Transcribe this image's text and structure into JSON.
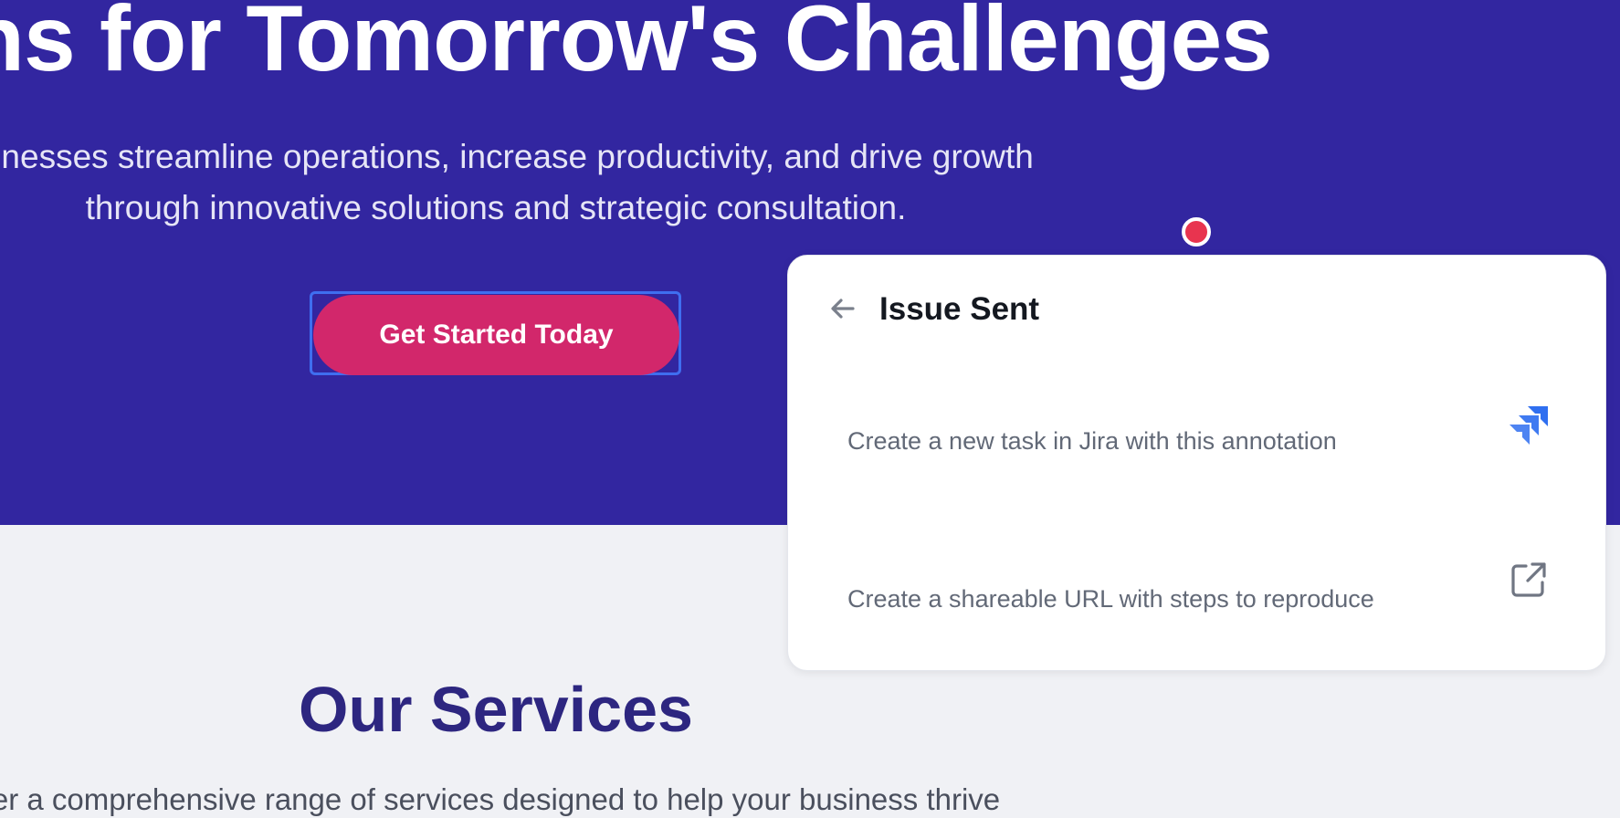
{
  "hero": {
    "title": "olutions for Tomorrow's Challenges",
    "subtitle_line1": "usinesses streamline operations, increase productivity, and drive growth",
    "subtitle_line2": "through innovative solutions and strategic consultation.",
    "cta_label": "Get Started Today"
  },
  "services": {
    "title": "Our Services",
    "subtitle": "er a comprehensive range of services designed to help your business thrive"
  },
  "panel": {
    "title": "Issue Sent",
    "options": [
      {
        "label": "Create a new task in Jira with this annotation",
        "icon": "jira-icon"
      },
      {
        "label": "Create a shareable URL with steps to reproduce",
        "icon": "external-link-icon"
      }
    ]
  },
  "colors": {
    "hero_bg": "#3226a0",
    "cta": "#d2276b",
    "focus_ring": "#3f6ef0",
    "marker": "#e8344f",
    "jira_blue": "#2f6ff0",
    "services_title": "#2d2680"
  }
}
